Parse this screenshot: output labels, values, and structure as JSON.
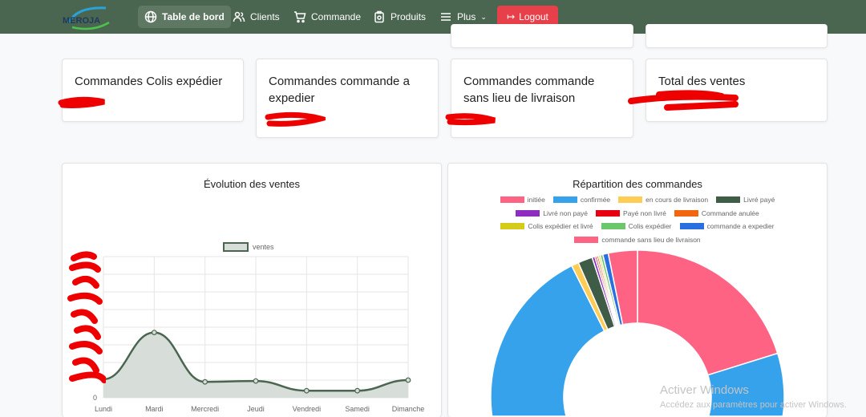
{
  "nav": {
    "brand": "MEROJA",
    "items": [
      {
        "label": "Table de bord",
        "icon": "globe-icon",
        "active": true
      },
      {
        "label": "Clients",
        "icon": "users-icon"
      },
      {
        "label": "Commande",
        "icon": "cart-icon"
      },
      {
        "label": "Produits",
        "icon": "box-icon"
      },
      {
        "label": "Plus",
        "icon": "menu-icon"
      }
    ],
    "logout": "Logout"
  },
  "cards": [
    {
      "title": "Commandes Colis expédier"
    },
    {
      "title": "Commandes commande a expedier"
    },
    {
      "title": "Commandes commande sans lieu de livraison"
    },
    {
      "title": "Total des ventes"
    }
  ],
  "chart_data": [
    {
      "type": "line",
      "title": "Évolution des ventes",
      "legend": [
        "ventes"
      ],
      "categories": [
        "Lundi",
        "Mardi",
        "Mercredi",
        "Jeudi",
        "Vendredi",
        "Samedi",
        "Dimanche"
      ],
      "values": [
        1.05,
        3.7,
        0.9,
        0.95,
        0.4,
        0.4,
        1.0
      ],
      "ylim": [
        0,
        8
      ],
      "ytick_visible": "0",
      "grid": true,
      "color": "#4b6650",
      "fill": "#d7ddd8"
    },
    {
      "type": "pie",
      "title": "Répartition des commandes",
      "legend_position": "top",
      "labels": [
        "initiée",
        "confirmée",
        "en cours de livraison",
        "Livré payé",
        "Livré non payé",
        "Payé non livré",
        "Commande anulée",
        "Colis expédier et livré",
        "Colis expédier",
        "commande a expedier",
        "commande sans lieu de livraison"
      ],
      "values": [
        20.2,
        72.4,
        0.8,
        1.6,
        0.3,
        0.2,
        0.2,
        0.2,
        0.3,
        0.6,
        3.2
      ],
      "colors": [
        "#ff6384",
        "#36a2eb",
        "#ffcd56",
        "#3e5c46",
        "#8e2dbf",
        "#e60012",
        "#f2660f",
        "#d4cc19",
        "#6cc66c",
        "#2a6fe0",
        "#ff6384"
      ]
    }
  ],
  "watermark": {
    "line1": "Activer Windows",
    "line2": "Accédez aux paramètres pour activer Windows."
  }
}
